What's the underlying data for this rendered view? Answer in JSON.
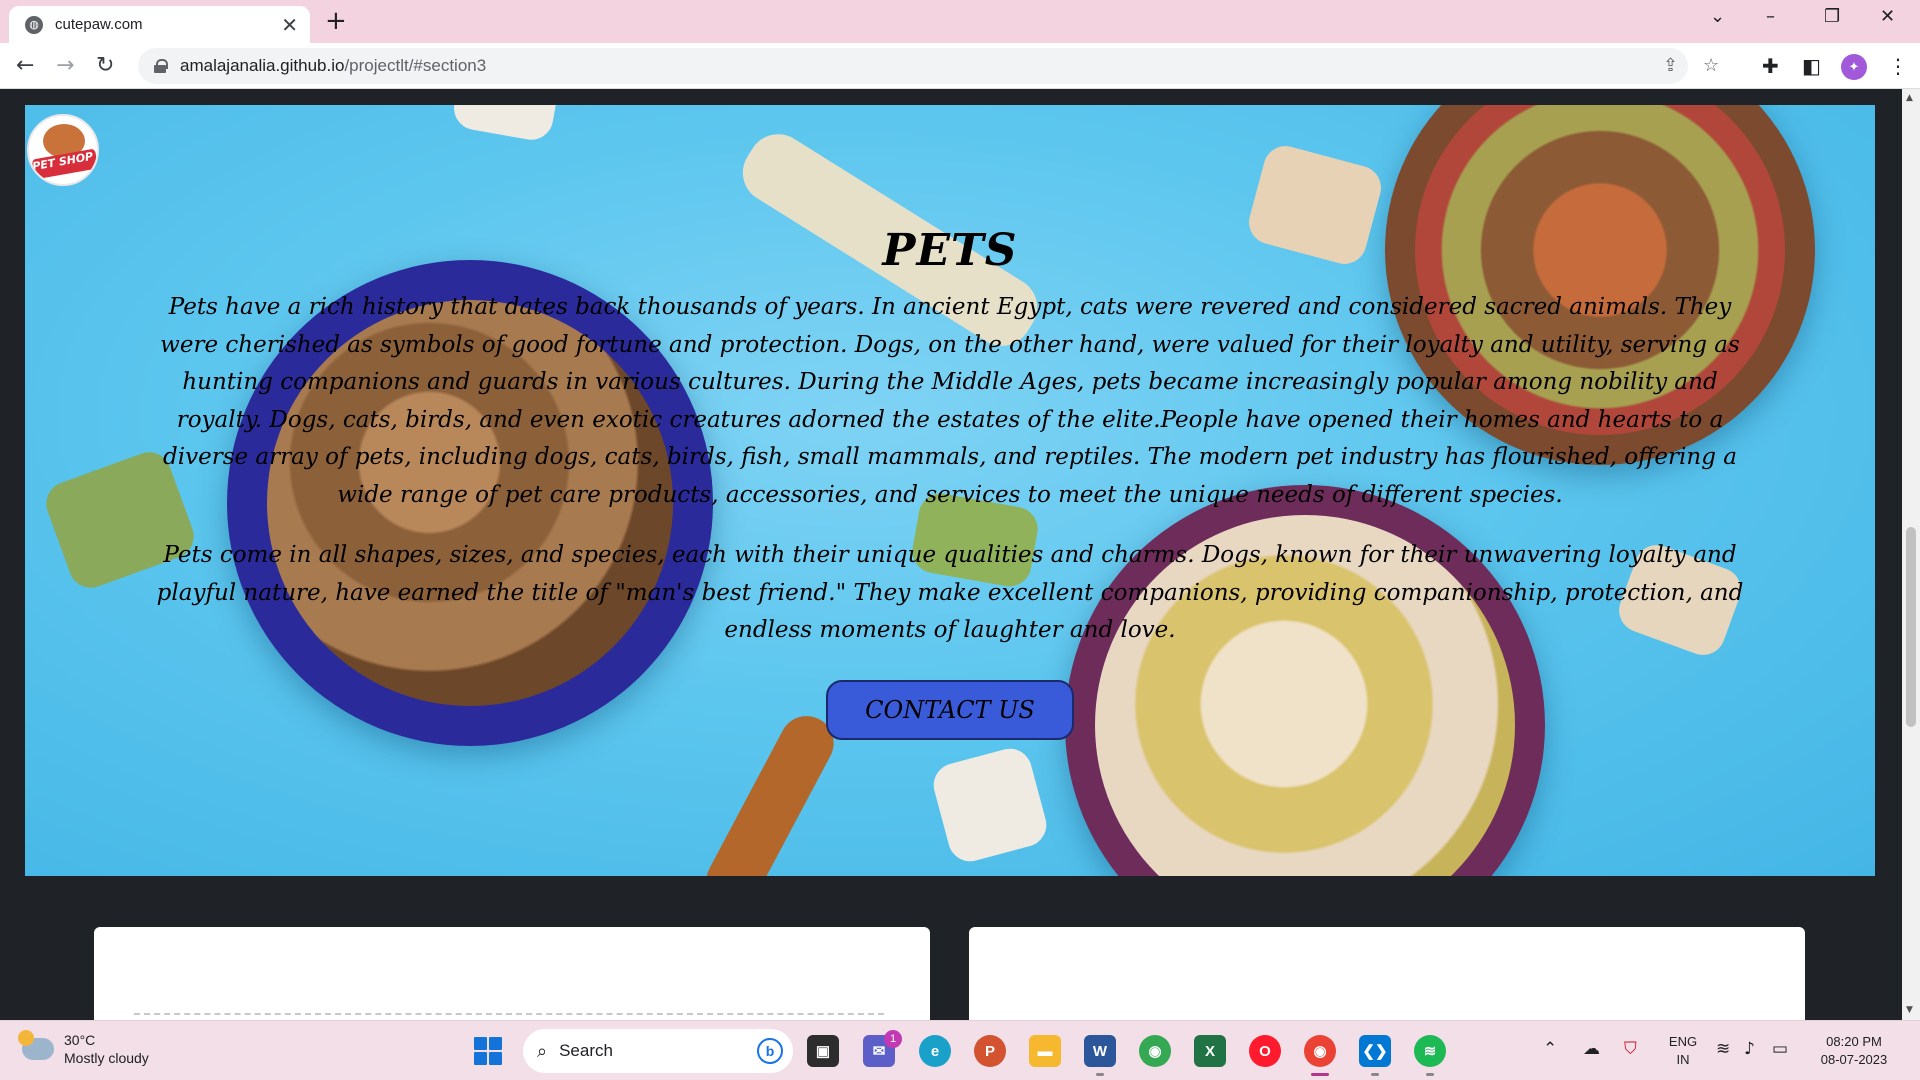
{
  "browser": {
    "tab_title": "cutepaw.com",
    "tab_close": "✕",
    "new_tab": "+",
    "url_host": "amalajanalia.github.io",
    "url_path": "/projectlt/#section3",
    "profile_initial": "✦"
  },
  "page": {
    "logo_text": "PET SHOP",
    "title": "PETS",
    "paragraph1": "Pets have a rich history that dates back thousands of years. In ancient Egypt, cats were revered and considered sacred animals. They were cherished as symbols of good fortune and protection. Dogs, on the other hand, were valued for their loyalty and utility, serving as hunting companions and guards in various cultures. During the Middle Ages, pets became increasingly popular among nobility and royalty. Dogs, cats, birds, and even exotic creatures adorned the estates of the elite.People have opened their homes and hearts to a diverse array of pets, including dogs, cats, birds, fish, small mammals, and reptiles. The modern pet industry has flourished, offering a wide range of pet care products, accessories, and services to meet the unique needs of different species.",
    "paragraph2": "Pets come in all shapes, sizes, and species, each with their unique qualities and charms. Dogs, known for their unwavering loyalty and playful nature, have earned the title of \"man's best friend.\" They make excellent companions, providing companionship, protection, and endless moments of laughter and love.",
    "contact_button": "CONTACT US"
  },
  "taskbar": {
    "weather_temp": "30°C",
    "weather_desc": "Mostly cloudy",
    "search_label": "Search",
    "chat_badge": "1",
    "lang_top": "ENG",
    "lang_bottom": "IN",
    "time": "08:20 PM",
    "date": "08-07-2023",
    "apps": [
      "task-view",
      "chat",
      "edge",
      "powerpoint",
      "file-explorer",
      "word",
      "chrome",
      "excel",
      "opera",
      "chrome-profile",
      "vscode",
      "spotify"
    ]
  },
  "colors": {
    "tabbar_bg": "#f3d3df",
    "hero_blue": "#5cc6ee",
    "button_blue": "#3a5bd9",
    "page_bg": "#1f2327"
  }
}
